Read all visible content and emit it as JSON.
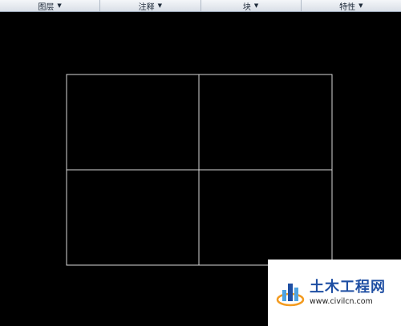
{
  "ribbon": {
    "panels": [
      {
        "label": "图层",
        "caret": "▼"
      },
      {
        "label": "注释",
        "caret": "▼"
      },
      {
        "label": "块",
        "caret": "▼"
      },
      {
        "label": "特性",
        "caret": "▼"
      }
    ]
  },
  "drawing": {
    "line_color": "#d9d9d9",
    "background": "#000000"
  },
  "watermark": {
    "title": "土木工程网",
    "url": "www.civilcn.com",
    "logo_icon": "building-bars-logo",
    "colors": {
      "blue": "#1f4fa3",
      "light_blue": "#4fa3e0",
      "orange": "#f39a1e"
    }
  }
}
